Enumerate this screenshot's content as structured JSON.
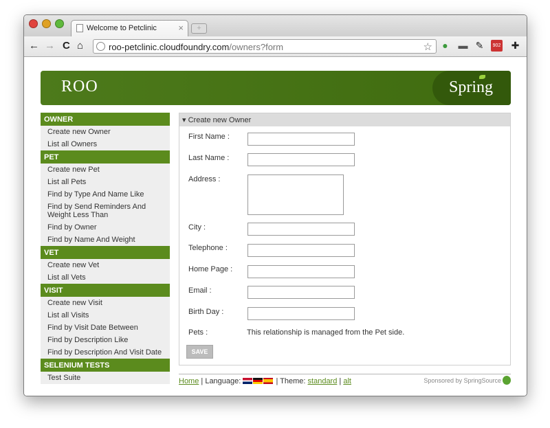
{
  "browser": {
    "tab_title": "Welcome to Petclinic",
    "tab_close": "×",
    "new_tab": "+",
    "url_host": "roo-petclinic.cloudfoundry.com",
    "url_path": "/owners?form",
    "back": "←",
    "forward": "→",
    "reload": "C",
    "home": "⌂",
    "star": "☆",
    "ext_gmail_badge": "902"
  },
  "banner": {
    "logo_text": "ROO",
    "spring_text": "Spring"
  },
  "menu": [
    {
      "header": "OWNER",
      "items": [
        "Create new Owner",
        "List all Owners"
      ]
    },
    {
      "header": "PET",
      "items": [
        "Create new Pet",
        "List all Pets",
        "Find by Type And Name Like",
        "Find by Send Reminders And Weight Less Than",
        "Find by Owner",
        "Find by Name And Weight"
      ]
    },
    {
      "header": "VET",
      "items": [
        "Create new Vet",
        "List all Vets"
      ]
    },
    {
      "header": "VISIT",
      "items": [
        "Create new Visit",
        "List all Visits",
        "Find by Visit Date Between",
        "Find by Description Like",
        "Find by Description And Visit Date"
      ]
    },
    {
      "header": "SELENIUM TESTS",
      "items": [
        "Test Suite"
      ]
    }
  ],
  "form": {
    "title": "Create new Owner",
    "fields": {
      "first_name": "First Name :",
      "last_name": "Last Name :",
      "address": "Address :",
      "city": "City :",
      "telephone": "Telephone :",
      "home_page": "Home Page :",
      "email": "Email :",
      "birth_day": "Birth Day :",
      "pets": "Pets :"
    },
    "pets_note": "This relationship is managed from the Pet side.",
    "save_label": "SAVE"
  },
  "footer": {
    "home": "Home",
    "language_label": "| Language:",
    "theme_label": "| Theme:",
    "theme_standard": "standard",
    "separator": "|",
    "theme_alt": "alt",
    "sponsored": "Sponsored by SpringSource"
  },
  "colors": {
    "brand_green": "#5b8b1d",
    "banner_green": "#4d7a1b"
  }
}
